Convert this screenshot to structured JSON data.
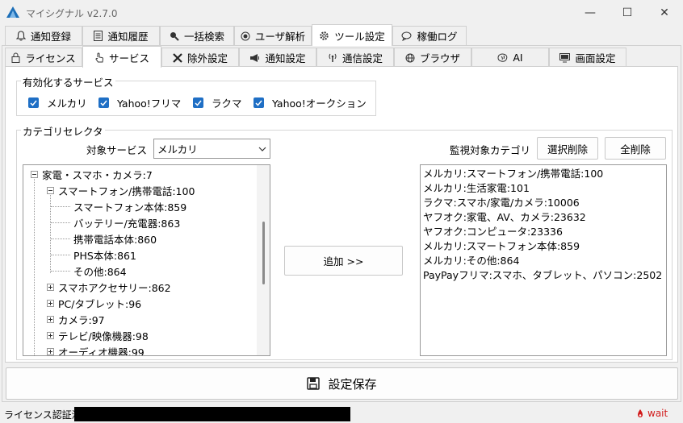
{
  "window": {
    "title": "マイシグナル v2.7.0",
    "controls": {
      "minimize": "—",
      "maximize": "☐",
      "close": "✕"
    }
  },
  "main_tabs": [
    {
      "label": "通知登録",
      "icon": "bell-icon"
    },
    {
      "label": "通知履歴",
      "icon": "document-icon"
    },
    {
      "label": "一括検索",
      "icon": "search-icon"
    },
    {
      "label": "ユーザ解析",
      "icon": "target-icon"
    },
    {
      "label": "ツール設定",
      "icon": "gear-icon",
      "selected": true
    },
    {
      "label": "稼働ログ",
      "icon": "chat-icon"
    }
  ],
  "sub_tabs": [
    {
      "label": "ライセンス",
      "icon": "lock-icon"
    },
    {
      "label": "サービス",
      "icon": "hand-pointer-icon",
      "selected": true
    },
    {
      "label": "除外設定",
      "icon": "x-icon"
    },
    {
      "label": "通知設定",
      "icon": "megaphone-icon"
    },
    {
      "label": "通信設定",
      "icon": "signal-icon"
    },
    {
      "label": "ブラウザ",
      "icon": "globe-icon"
    },
    {
      "label": "AI",
      "icon": "brain-icon"
    },
    {
      "label": "画面設定",
      "icon": "monitor-icon"
    }
  ],
  "services_group": {
    "label": "有効化するサービス",
    "items": [
      {
        "label": "メルカリ",
        "checked": true
      },
      {
        "label": "Yahoo!フリマ",
        "checked": true
      },
      {
        "label": "ラクマ",
        "checked": true
      },
      {
        "label": "Yahoo!オークション",
        "checked": true
      }
    ]
  },
  "category_group": {
    "label": "カテゴリセレクタ",
    "target_service_label": "対象サービス",
    "target_service_value": "メルカリ",
    "monitored_label": "監視対象カテゴリ",
    "delete_selected_label": "選択削除",
    "delete_all_label": "全削除",
    "add_button_label": "追加 >>",
    "tree": [
      {
        "label": "家電・スマホ・カメラ:7",
        "level": 0,
        "expander": "minus"
      },
      {
        "label": "スマートフォン/携帯電話:100",
        "level": 1,
        "expander": "minus"
      },
      {
        "label": "スマートフォン本体:859",
        "level": 2
      },
      {
        "label": "バッテリー/充電器:863",
        "level": 2
      },
      {
        "label": "携帯電話本体:860",
        "level": 2
      },
      {
        "label": "PHS本体:861",
        "level": 2
      },
      {
        "label": "その他:864",
        "level": 2
      },
      {
        "label": "スマホアクセサリー:862",
        "level": 1,
        "expander": "plus"
      },
      {
        "label": "PC/タブレット:96",
        "level": 1,
        "expander": "plus"
      },
      {
        "label": "カメラ:97",
        "level": 1,
        "expander": "plus"
      },
      {
        "label": "テレビ/映像機器:98",
        "level": 1,
        "expander": "plus"
      },
      {
        "label": "オーディオ機器:99",
        "level": 1,
        "expander": "plus"
      }
    ],
    "monitored": [
      "メルカリ:スマートフォン/携帯電話:100",
      "メルカリ:生活家電:101",
      "ラクマ:スマホ/家電/カメラ:10006",
      "ヤフオク:家電、AV、カメラ:23632",
      "ヤフオク:コンピュータ:23336",
      "メルカリ:スマートフォン本体:859",
      "メルカリ:その他:864",
      "PayPayフリマ:スマホ、タブレット、パソコン:2502"
    ]
  },
  "save_button_label": "設定保存",
  "status": {
    "license_label": "ライセンス認証済：",
    "wait_label": "wait"
  },
  "colors": {
    "accent": "#1f6fc5",
    "wait": "#d11a1a",
    "redacted": "#000000"
  }
}
